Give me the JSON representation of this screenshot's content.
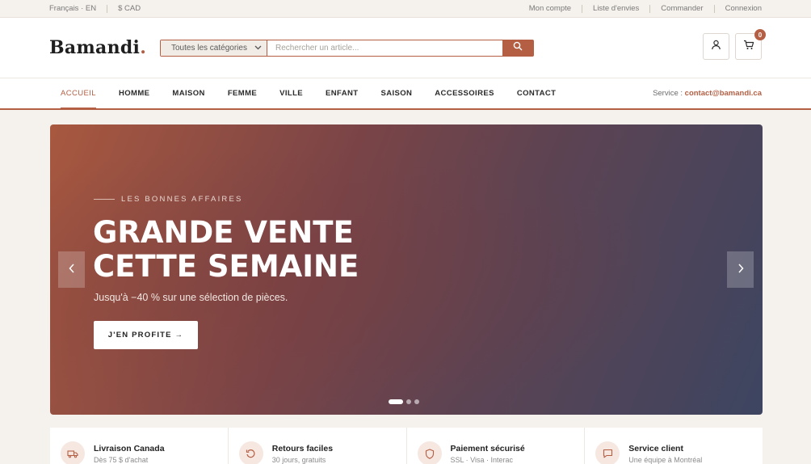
{
  "topbar": {
    "language": "Français · EN",
    "currency": "$ CAD",
    "links": [
      "Mon compte",
      "Liste d'envies",
      "Commander",
      "Connexion"
    ]
  },
  "header": {
    "logo_text": "Bamandi",
    "logo_dot": ".",
    "category_select": "Toutes les catégories",
    "search_placeholder": "Rechercher un article...",
    "cart_count": "0"
  },
  "nav": {
    "items": [
      "ACCUEIL",
      "HOMME",
      "MAISON",
      "FEMME",
      "VILLE",
      "ENFANT",
      "SAISON",
      "ACCESSOIRES",
      "CONTACT"
    ],
    "active_index": 0,
    "service_label": "Service : ",
    "service_email": "contact@bamandi.ca"
  },
  "hero": {
    "eyebrow": "LES BONNES AFFAIRES",
    "title_line1": "GRANDE VENTE",
    "title_line2": "CETTE SEMAINE",
    "subtitle": "Jusqu'à −40 % sur une sélection de pièces.",
    "cta_label": "J'EN PROFITE →",
    "slide_count": 3,
    "active_slide": 0
  },
  "features": [
    {
      "title": "Livraison Canada",
      "subtitle": "Dès 75 $ d'achat",
      "icon": "truck-icon"
    },
    {
      "title": "Retours faciles",
      "subtitle": "30 jours, gratuits",
      "icon": "return-icon"
    },
    {
      "title": "Paiement sécurisé",
      "subtitle": "SSL · Visa · Interac",
      "icon": "shield-icon"
    },
    {
      "title": "Service client",
      "subtitle": "Une équipe à Montréal",
      "icon": "chat-icon"
    }
  ],
  "colors": {
    "accent": "#b45f44",
    "background": "#f5f1ec"
  }
}
